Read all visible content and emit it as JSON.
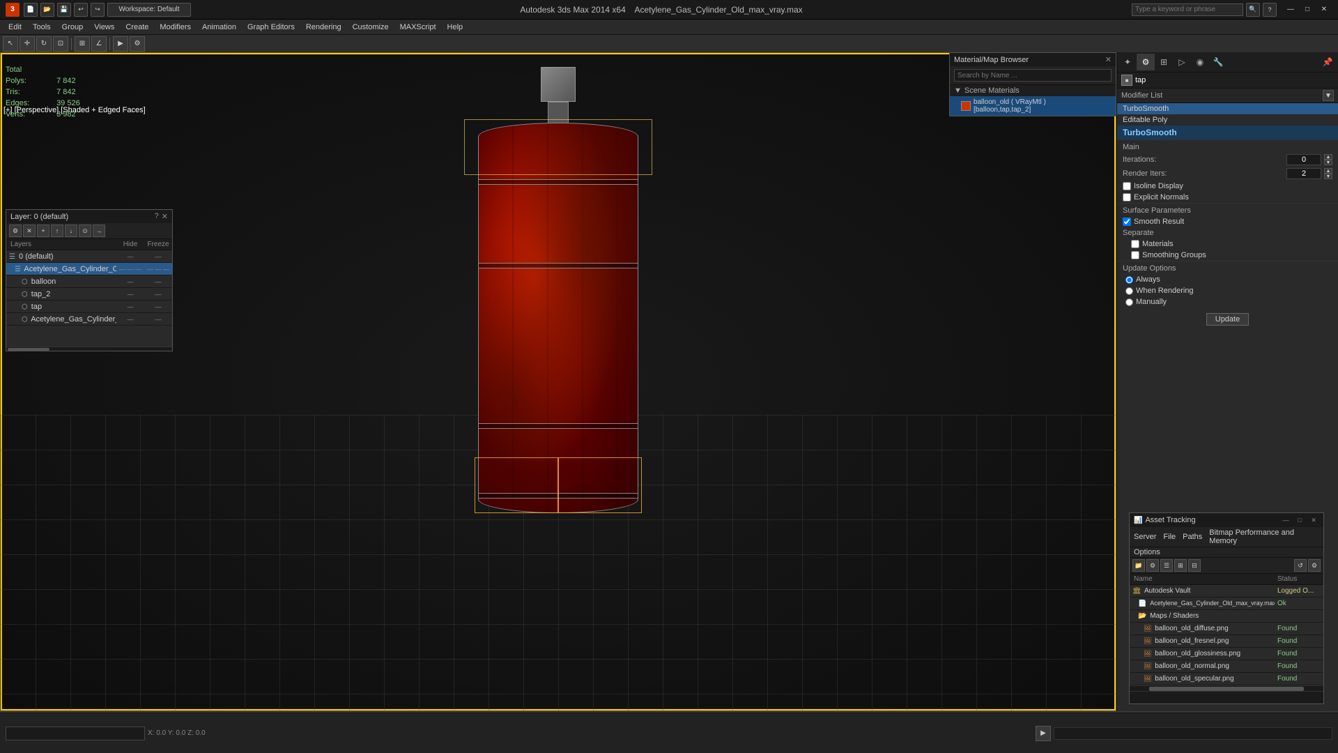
{
  "app": {
    "title": "Autodesk 3ds Max 2014 x64",
    "file": "Acetylene_Gas_Cylinder_Old_max_vray.max",
    "workspace": "Workspace: Default",
    "search_placeholder": "Type a keyword or phrase"
  },
  "menu": {
    "items": [
      "Edit",
      "Tools",
      "Group",
      "Views",
      "Create",
      "Modifiers",
      "Animation",
      "Graph Editors",
      "Rendering",
      "Customize",
      "MAXScript",
      "Help"
    ]
  },
  "viewport": {
    "label": "[+] [Perspective] [Shaded + Edged Faces]",
    "stats": {
      "polys_label": "Polys:",
      "polys_value": "7 842",
      "tris_label": "Tris:",
      "tris_value": "7 842",
      "edges_label": "Edges:",
      "edges_value": "39 526",
      "verts_label": "Verts:",
      "verts_value": "3 982",
      "total_label": "Total"
    }
  },
  "material_browser": {
    "title": "Material/Map Browser",
    "search_label": "Search by Name ...",
    "scene_materials_label": "Scene Materials",
    "material_name": "balloon_old ( VRayMtl ) [balloon,tap,tap_2]"
  },
  "modifier_panel": {
    "name_label": "tap",
    "modifier_list_label": "Modifier List",
    "turbosmooth_label": "TurboSmooth",
    "editable_poly_label": "Editable Poly",
    "main_section": "Main",
    "iterations_label": "Iterations:",
    "iterations_value": "0",
    "render_iters_label": "Render Iters:",
    "render_iters_value": "2",
    "isoline_label": "Isoline Display",
    "explicit_normals_label": "Explicit Normals",
    "surface_params_label": "Surface Parameters",
    "smooth_result_label": "Smooth Result",
    "smooth_result_checked": true,
    "separate_label": "Separate",
    "materials_label": "Materials",
    "smoothing_groups_label": "Smoothing Groups",
    "update_options_label": "Update Options",
    "always_label": "Always",
    "when_rendering_label": "When Rendering",
    "manually_label": "Manually",
    "update_btn_label": "Update"
  },
  "layers": {
    "title": "Layer: 0 (default)",
    "help_btn": "?",
    "columns": [
      "Layers",
      "Hide",
      "Freeze"
    ],
    "items": [
      {
        "name": "0 (default)",
        "indent": 0,
        "type": "layer",
        "hide": "",
        "freeze": ""
      },
      {
        "name": "Acetylene_Gas_Cylinder_Old",
        "indent": 1,
        "type": "layer",
        "selected": true,
        "hide": "— — —",
        "freeze": "— — —"
      },
      {
        "name": "balloon",
        "indent": 2,
        "type": "object",
        "hide": "—",
        "freeze": "—"
      },
      {
        "name": "tap_2",
        "indent": 2,
        "type": "object",
        "hide": "—",
        "freeze": "—"
      },
      {
        "name": "tap",
        "indent": 2,
        "type": "object",
        "hide": "—",
        "freeze": "—"
      },
      {
        "name": "Acetylene_Gas_Cylinder_Old",
        "indent": 2,
        "type": "object",
        "hide": "—",
        "freeze": "—"
      }
    ]
  },
  "asset_tracking": {
    "title": "Asset Tracking",
    "menu_items": [
      "Server",
      "File",
      "Paths",
      "Bitmap Performance and Memory",
      "Options"
    ],
    "columns": [
      "Name",
      "Status"
    ],
    "items": [
      {
        "name": "Autodesk Vault",
        "indent": 0,
        "type": "vault",
        "status": "Logged O..."
      },
      {
        "name": "Acetylene_Gas_Cylinder_Old_max_vray.max",
        "indent": 1,
        "type": "file",
        "status": "Ok"
      },
      {
        "name": "Maps / Shaders",
        "indent": 1,
        "type": "folder",
        "status": ""
      },
      {
        "name": "balloon_old_diffuse.png",
        "indent": 2,
        "type": "map",
        "status": "Found"
      },
      {
        "name": "balloon_old_fresnel.png",
        "indent": 2,
        "type": "map",
        "status": "Found"
      },
      {
        "name": "balloon_old_glossiness.png",
        "indent": 2,
        "type": "map",
        "status": "Found"
      },
      {
        "name": "balloon_old_normal.png",
        "indent": 2,
        "type": "map",
        "status": "Found"
      },
      {
        "name": "balloon_old_specular.png",
        "indent": 2,
        "type": "map",
        "status": "Found"
      }
    ]
  },
  "icons": {
    "close": "✕",
    "minimize": "—",
    "maximize": "□",
    "arrow_down": "▼",
    "arrow_right": "▶",
    "check": "✓",
    "folder": "📁",
    "file": "📄",
    "map": "🖼"
  }
}
